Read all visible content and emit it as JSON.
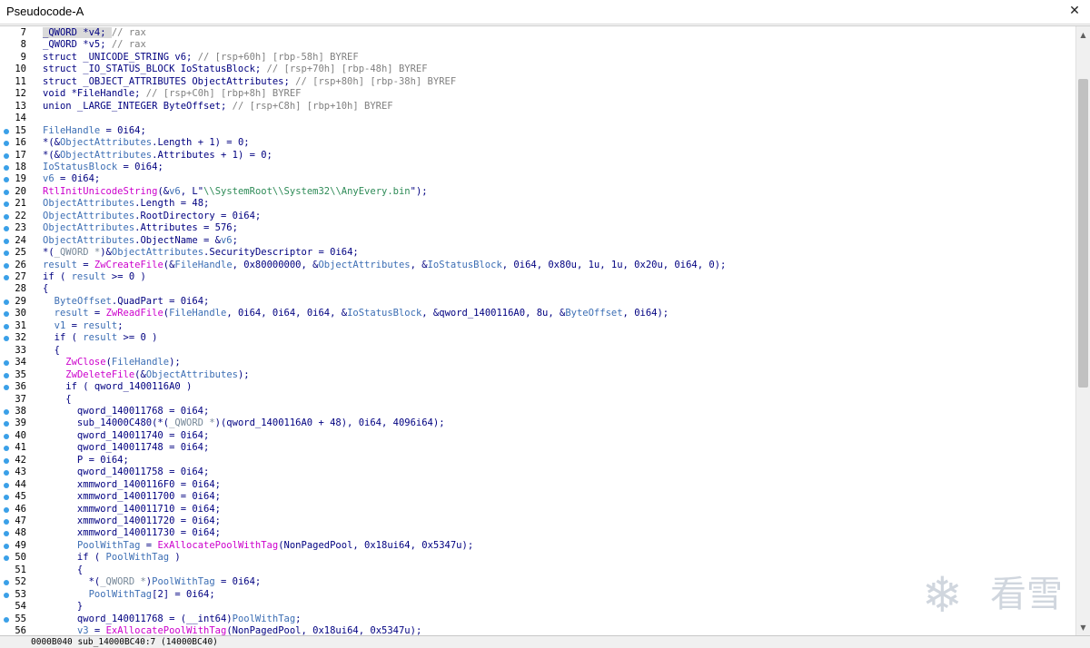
{
  "window": {
    "title": "Pseudocode-A",
    "close_glyph": "✕"
  },
  "status": {
    "text": "0000B040 sub_14000BC40:7 (14000BC40)"
  },
  "watermark": {
    "text": "看雪",
    "icon": "snowflake-icon"
  },
  "colors": {
    "keyword": "#000080",
    "comment": "#808080",
    "function": "#cc00cc",
    "global": "#778899",
    "local": "#3c6eb4",
    "string": "#2e8b57",
    "breakpoint": "#3aa0e8"
  },
  "lines": [
    {
      "n": "7",
      "dot": false,
      "hl": true,
      "t": [
        [
          "k",
          "_QWORD *v4; "
        ],
        [
          "c",
          "// rax"
        ]
      ]
    },
    {
      "n": "8",
      "dot": false,
      "t": [
        [
          "k",
          "_QWORD *v5; "
        ],
        [
          "c",
          "// rax"
        ]
      ]
    },
    {
      "n": "9",
      "dot": false,
      "t": [
        [
          "k",
          "struct _UNICODE_STRING v6; "
        ],
        [
          "c",
          "// [rsp+60h] [rbp-58h] BYREF"
        ]
      ]
    },
    {
      "n": "10",
      "dot": false,
      "t": [
        [
          "k",
          "struct _IO_STATUS_BLOCK IoStatusBlock; "
        ],
        [
          "c",
          "// [rsp+70h] [rbp-48h] BYREF"
        ]
      ]
    },
    {
      "n": "11",
      "dot": false,
      "t": [
        [
          "k",
          "struct _OBJECT_ATTRIBUTES ObjectAttributes; "
        ],
        [
          "c",
          "// [rsp+80h] [rbp-38h] BYREF"
        ]
      ]
    },
    {
      "n": "12",
      "dot": false,
      "t": [
        [
          "k",
          "void *FileHandle; "
        ],
        [
          "c",
          "// [rsp+C0h] [rbp+8h] BYREF"
        ]
      ]
    },
    {
      "n": "13",
      "dot": false,
      "t": [
        [
          "k",
          "union _LARGE_INTEGER ByteOffset; "
        ],
        [
          "c",
          "// [rsp+C8h] [rbp+10h] BYREF"
        ]
      ]
    },
    {
      "n": "14",
      "dot": false,
      "t": []
    },
    {
      "n": "15",
      "dot": true,
      "t": [
        [
          "n",
          "FileHandle"
        ],
        [
          "k",
          " = 0i64;"
        ]
      ]
    },
    {
      "n": "16",
      "dot": true,
      "t": [
        [
          "k",
          "*(&"
        ],
        [
          "n",
          "ObjectAttributes"
        ],
        [
          "k",
          ".Length + 1) = 0;"
        ]
      ]
    },
    {
      "n": "17",
      "dot": true,
      "t": [
        [
          "k",
          "*(&"
        ],
        [
          "n",
          "ObjectAttributes"
        ],
        [
          "k",
          ".Attributes + 1) = 0;"
        ]
      ]
    },
    {
      "n": "18",
      "dot": true,
      "t": [
        [
          "n",
          "IoStatusBlock"
        ],
        [
          "k",
          " = 0i64;"
        ]
      ]
    },
    {
      "n": "19",
      "dot": true,
      "t": [
        [
          "n",
          "v6"
        ],
        [
          "k",
          " = 0i64;"
        ]
      ]
    },
    {
      "n": "20",
      "dot": true,
      "t": [
        [
          "f",
          "RtlInitUnicodeString"
        ],
        [
          "k",
          "(&"
        ],
        [
          "n",
          "v6"
        ],
        [
          "k",
          ", L\""
        ],
        [
          "s",
          "\\\\SystemRoot\\\\System32\\\\AnyEvery.bin"
        ],
        [
          "k",
          "\");"
        ]
      ]
    },
    {
      "n": "21",
      "dot": true,
      "t": [
        [
          "n",
          "ObjectAttributes"
        ],
        [
          "k",
          ".Length = 48;"
        ]
      ]
    },
    {
      "n": "22",
      "dot": true,
      "t": [
        [
          "n",
          "ObjectAttributes"
        ],
        [
          "k",
          ".RootDirectory = 0i64;"
        ]
      ]
    },
    {
      "n": "23",
      "dot": true,
      "t": [
        [
          "n",
          "ObjectAttributes"
        ],
        [
          "k",
          ".Attributes = 576;"
        ]
      ]
    },
    {
      "n": "24",
      "dot": true,
      "t": [
        [
          "n",
          "ObjectAttributes"
        ],
        [
          "k",
          ".ObjectName = &"
        ],
        [
          "n",
          "v6"
        ],
        [
          "k",
          ";"
        ]
      ]
    },
    {
      "n": "25",
      "dot": true,
      "t": [
        [
          "k",
          "*("
        ],
        [
          "g",
          "_QWORD *"
        ],
        [
          "k",
          ")&"
        ],
        [
          "n",
          "ObjectAttributes"
        ],
        [
          "k",
          ".SecurityDescriptor = 0i64;"
        ]
      ]
    },
    {
      "n": "26",
      "dot": true,
      "t": [
        [
          "n",
          "result"
        ],
        [
          "k",
          " = "
        ],
        [
          "f",
          "ZwCreateFile"
        ],
        [
          "k",
          "(&"
        ],
        [
          "n",
          "FileHandle"
        ],
        [
          "k",
          ", 0x80000000, &"
        ],
        [
          "n",
          "ObjectAttributes"
        ],
        [
          "k",
          ", &"
        ],
        [
          "n",
          "IoStatusBlock"
        ],
        [
          "k",
          ", 0i64, 0x80u, 1u, 1u, 0x20u, 0i64, 0);"
        ]
      ]
    },
    {
      "n": "27",
      "dot": true,
      "t": [
        [
          "k",
          "if ( "
        ],
        [
          "n",
          "result"
        ],
        [
          "k",
          " >= 0 )"
        ]
      ]
    },
    {
      "n": "28",
      "dot": false,
      "t": [
        [
          "k",
          "{"
        ]
      ]
    },
    {
      "n": "29",
      "dot": true,
      "t": [
        [
          "k",
          "  "
        ],
        [
          "n",
          "ByteOffset"
        ],
        [
          "k",
          ".QuadPart = 0i64;"
        ]
      ]
    },
    {
      "n": "30",
      "dot": true,
      "t": [
        [
          "k",
          "  "
        ],
        [
          "n",
          "result"
        ],
        [
          "k",
          " = "
        ],
        [
          "f",
          "ZwReadFile"
        ],
        [
          "k",
          "("
        ],
        [
          "n",
          "FileHandle"
        ],
        [
          "k",
          ", 0i64, 0i64, 0i64, &"
        ],
        [
          "n",
          "IoStatusBlock"
        ],
        [
          "k",
          ", &qword_1400116A0, 8u, &"
        ],
        [
          "n",
          "ByteOffset"
        ],
        [
          "k",
          ", 0i64);"
        ]
      ]
    },
    {
      "n": "31",
      "dot": true,
      "t": [
        [
          "k",
          "  "
        ],
        [
          "n",
          "v1"
        ],
        [
          "k",
          " = "
        ],
        [
          "n",
          "result"
        ],
        [
          "k",
          ";"
        ]
      ]
    },
    {
      "n": "32",
      "dot": true,
      "t": [
        [
          "k",
          "  if ( "
        ],
        [
          "n",
          "result"
        ],
        [
          "k",
          " >= 0 )"
        ]
      ]
    },
    {
      "n": "33",
      "dot": false,
      "t": [
        [
          "k",
          "  {"
        ]
      ]
    },
    {
      "n": "34",
      "dot": true,
      "t": [
        [
          "k",
          "    "
        ],
        [
          "f",
          "ZwClose"
        ],
        [
          "k",
          "("
        ],
        [
          "n",
          "FileHandle"
        ],
        [
          "k",
          ");"
        ]
      ]
    },
    {
      "n": "35",
      "dot": true,
      "t": [
        [
          "k",
          "    "
        ],
        [
          "f",
          "ZwDeleteFile"
        ],
        [
          "k",
          "(&"
        ],
        [
          "n",
          "ObjectAttributes"
        ],
        [
          "k",
          ");"
        ]
      ]
    },
    {
      "n": "36",
      "dot": true,
      "t": [
        [
          "k",
          "    if ( qword_1400116A0 )"
        ]
      ]
    },
    {
      "n": "37",
      "dot": false,
      "t": [
        [
          "k",
          "    {"
        ]
      ]
    },
    {
      "n": "38",
      "dot": true,
      "t": [
        [
          "k",
          "      qword_140011768 = 0i64;"
        ]
      ]
    },
    {
      "n": "39",
      "dot": true,
      "t": [
        [
          "k",
          "      sub_14000C480(*("
        ],
        [
          "g",
          "_QWORD *"
        ],
        [
          "k",
          ")(qword_1400116A0 + 48), 0i64, 4096i64);"
        ]
      ]
    },
    {
      "n": "40",
      "dot": true,
      "t": [
        [
          "k",
          "      qword_140011740 = 0i64;"
        ]
      ]
    },
    {
      "n": "41",
      "dot": true,
      "t": [
        [
          "k",
          "      qword_140011748 = 0i64;"
        ]
      ]
    },
    {
      "n": "42",
      "dot": true,
      "t": [
        [
          "k",
          "      P = 0i64;"
        ]
      ]
    },
    {
      "n": "43",
      "dot": true,
      "t": [
        [
          "k",
          "      qword_140011758 = 0i64;"
        ]
      ]
    },
    {
      "n": "44",
      "dot": true,
      "t": [
        [
          "k",
          "      xmmword_1400116F0 = 0i64;"
        ]
      ]
    },
    {
      "n": "45",
      "dot": true,
      "t": [
        [
          "k",
          "      xmmword_140011700 = 0i64;"
        ]
      ]
    },
    {
      "n": "46",
      "dot": true,
      "t": [
        [
          "k",
          "      xmmword_140011710 = 0i64;"
        ]
      ]
    },
    {
      "n": "47",
      "dot": true,
      "t": [
        [
          "k",
          "      xmmword_140011720 = 0i64;"
        ]
      ]
    },
    {
      "n": "48",
      "dot": true,
      "t": [
        [
          "k",
          "      xmmword_140011730 = 0i64;"
        ]
      ]
    },
    {
      "n": "49",
      "dot": true,
      "t": [
        [
          "k",
          "      "
        ],
        [
          "n",
          "PoolWithTag"
        ],
        [
          "k",
          " = "
        ],
        [
          "f",
          "ExAllocatePoolWithTag"
        ],
        [
          "k",
          "(NonPagedPool, 0x18ui64, 0x5347u);"
        ]
      ]
    },
    {
      "n": "50",
      "dot": true,
      "t": [
        [
          "k",
          "      if ( "
        ],
        [
          "n",
          "PoolWithTag"
        ],
        [
          "k",
          " )"
        ]
      ]
    },
    {
      "n": "51",
      "dot": false,
      "t": [
        [
          "k",
          "      {"
        ]
      ]
    },
    {
      "n": "52",
      "dot": true,
      "t": [
        [
          "k",
          "        *("
        ],
        [
          "g",
          "_QWORD *"
        ],
        [
          "k",
          ")"
        ],
        [
          "n",
          "PoolWithTag"
        ],
        [
          "k",
          " = 0i64;"
        ]
      ]
    },
    {
      "n": "53",
      "dot": true,
      "t": [
        [
          "k",
          "        "
        ],
        [
          "n",
          "PoolWithTag"
        ],
        [
          "k",
          "[2] = 0i64;"
        ]
      ]
    },
    {
      "n": "54",
      "dot": false,
      "t": [
        [
          "k",
          "      }"
        ]
      ]
    },
    {
      "n": "55",
      "dot": true,
      "t": [
        [
          "k",
          "      qword_140011768 = (__int64)"
        ],
        [
          "n",
          "PoolWithTag"
        ],
        [
          "k",
          ";"
        ]
      ]
    },
    {
      "n": "56",
      "dot": false,
      "t": [
        [
          "k",
          "      "
        ],
        [
          "n",
          "v3"
        ],
        [
          "k",
          " = "
        ],
        [
          "f",
          "ExAllocatePoolWithTag"
        ],
        [
          "k",
          "(NonPagedPool, 0x18ui64, 0x5347u);"
        ]
      ]
    }
  ]
}
